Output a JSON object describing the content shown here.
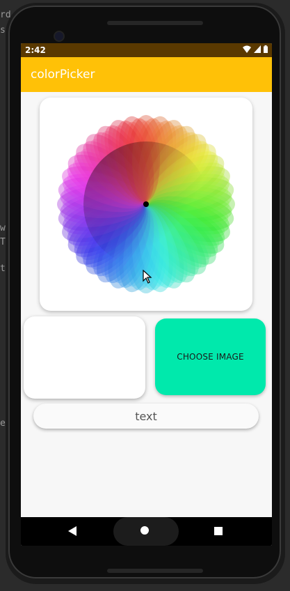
{
  "status_bar": {
    "time": "2:42"
  },
  "app_bar": {
    "title": "colorPicker"
  },
  "content": {
    "choose_image_label": "CHOOSE IMAGE",
    "text_field_value": "text"
  },
  "ide_fragments": [
    "rd",
    "se",
    "w",
    "T",
    "t",
    "er"
  ],
  "colors": {
    "status_bar": "#5a3900",
    "app_bar": "#ffc107",
    "choose_button": "#00e9ac",
    "screen_bg": "#f7f7f7"
  },
  "icons": {
    "wifi": "wifi-icon",
    "signal": "signal-icon",
    "battery": "battery-icon",
    "back": "back-triangle-icon",
    "home": "home-circle-icon",
    "recents": "recents-square-icon"
  }
}
